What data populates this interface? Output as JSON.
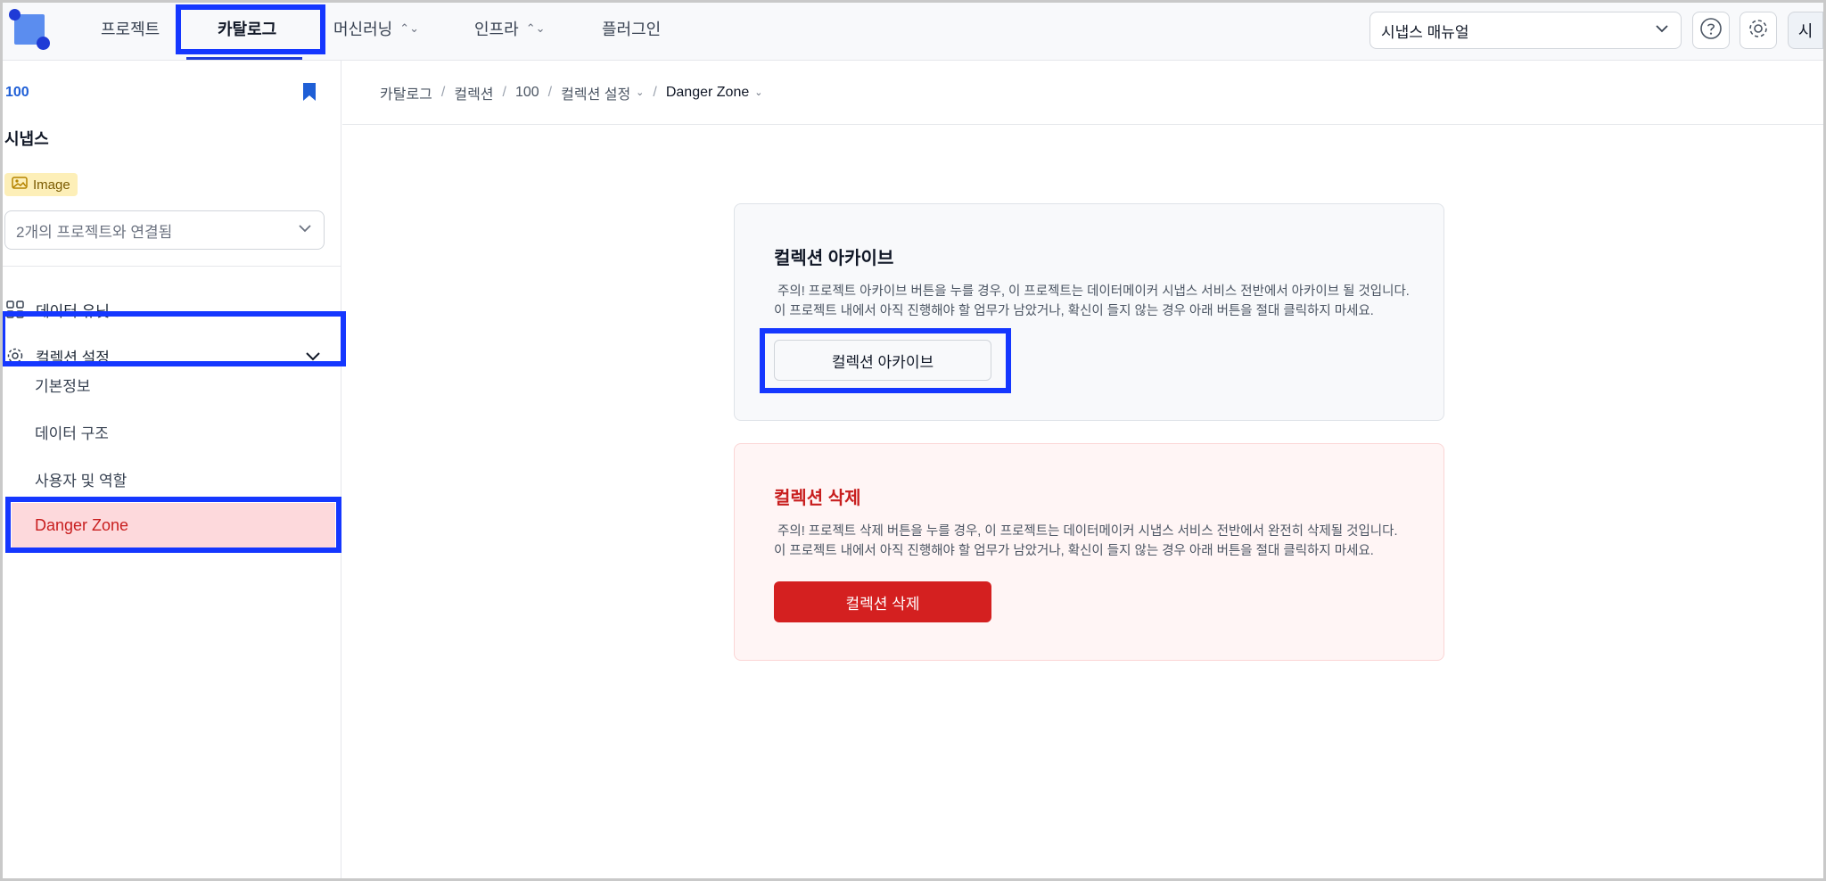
{
  "nav": {
    "items": [
      {
        "label": "프로젝트"
      },
      {
        "label": "카탈로그"
      },
      {
        "label": "머신러닝"
      },
      {
        "label": "인프라"
      },
      {
        "label": "플러그인"
      }
    ],
    "manual_select": "시냅스 매뉴얼",
    "avatar_initial": "시"
  },
  "sidebar": {
    "collection_id": "100",
    "collection_name": "시냅스",
    "type_badge": "Image",
    "project_select": "2개의 프로젝트와 연결됨",
    "items": [
      {
        "label": "데이터 유닛"
      },
      {
        "label": "컬렉션 설정"
      }
    ],
    "sub_items": [
      {
        "label": "기본정보"
      },
      {
        "label": "데이터 구조"
      },
      {
        "label": "사용자 및 역할"
      },
      {
        "label": "Danger Zone"
      }
    ]
  },
  "breadcrumb": [
    "카탈로그",
    "컬렉션",
    "100",
    "컬렉션 설정",
    "Danger Zone"
  ],
  "archive": {
    "title": "컬렉션 아카이브",
    "desc_line1": " 주의! 프로젝트 아카이브 버튼을 누를 경우, 이 프로젝트는 데이터메이커 시냅스 서비스 전반에서 아카이브 될 것입니다.",
    "desc_line2": "이 프로젝트 내에서 아직 진행해야 할 업무가 남았거나, 확신이 들지 않는 경우 아래 버튼을 절대 클릭하지 마세요.",
    "button": "컬렉션 아카이브"
  },
  "delete": {
    "title": "컬렉션 삭제",
    "desc_line1": " 주의! 프로젝트 삭제 버튼을 누를 경우, 이 프로젝트는 데이터메이커 시냅스 서비스 전반에서 완전히 삭제될 것입니다.",
    "desc_line2": "이 프로젝트 내에서 아직 진행해야 할 업무가 남았거나, 확신이 들지 않는 경우 아래 버튼을 절대 클릭하지 마세요.",
    "button": "컬렉션 삭제"
  },
  "colors": {
    "accent": "#1f3bd6",
    "highlight": "#1537ff",
    "danger": "#d42020",
    "danger_bg": "#fdd9dc",
    "badge_bg": "#fdefb8"
  },
  "icons": {
    "logo": "logo-icon",
    "help": "help-icon",
    "settings": "gear-icon",
    "bookmark": "bookmark-icon",
    "image": "image-icon",
    "grid": "grid-icon",
    "chevron": "chevron-down-icon"
  }
}
